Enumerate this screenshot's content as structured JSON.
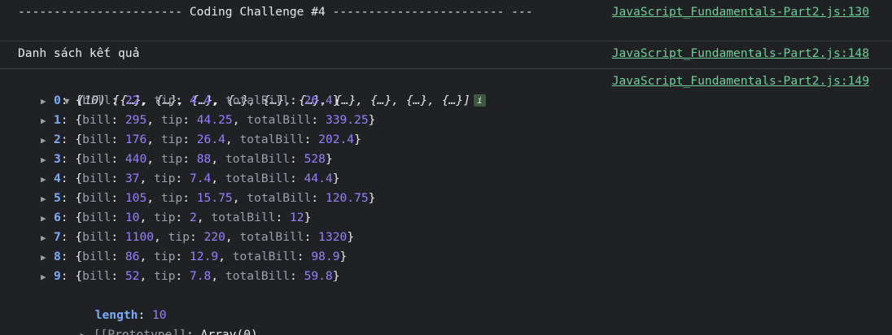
{
  "messages": [
    {
      "text": "----------------------- Coding Challenge #4 ------------------------ ---",
      "source": "JavaScript_Fundamentals-Part2.js:130"
    },
    {
      "text": "Danh sách kết quả",
      "source": "JavaScript_Fundamentals-Part2.js:148"
    },
    {
      "source": "JavaScript_Fundamentals-Part2.js:149",
      "array_preview": "(10) [{…}, {…}, {…}, {…}, {…}, {…}, {…}, {…}, {…}, {…}]",
      "info_badge": "i",
      "entries": [
        {
          "index": "0",
          "bill": "22",
          "tip": "4.4",
          "totalBill": "26.4"
        },
        {
          "index": "1",
          "bill": "295",
          "tip": "44.25",
          "totalBill": "339.25"
        },
        {
          "index": "2",
          "bill": "176",
          "tip": "26.4",
          "totalBill": "202.4"
        },
        {
          "index": "3",
          "bill": "440",
          "tip": "88",
          "totalBill": "528"
        },
        {
          "index": "4",
          "bill": "37",
          "tip": "7.4",
          "totalBill": "44.4"
        },
        {
          "index": "5",
          "bill": "105",
          "tip": "15.75",
          "totalBill": "120.75"
        },
        {
          "index": "6",
          "bill": "10",
          "tip": "2",
          "totalBill": "12"
        },
        {
          "index": "7",
          "bill": "1100",
          "tip": "220",
          "totalBill": "1320"
        },
        {
          "index": "8",
          "bill": "86",
          "tip": "12.9",
          "totalBill": "98.9"
        },
        {
          "index": "9",
          "bill": "52",
          "tip": "7.8",
          "totalBill": "59.8"
        }
      ],
      "length_key": "length",
      "length_value": "10",
      "prototype_key": "[[Prototype]]",
      "prototype_value": "Array(0)"
    }
  ],
  "colors": {
    "background": "#202124",
    "link": "#6fcf97",
    "number": "#9980ff",
    "index": "#7cacf8",
    "key": "#9aa0a6"
  },
  "icons": {
    "expanded": "triangle-down-icon",
    "collapsed": "triangle-right-icon",
    "info": "info-icon"
  }
}
